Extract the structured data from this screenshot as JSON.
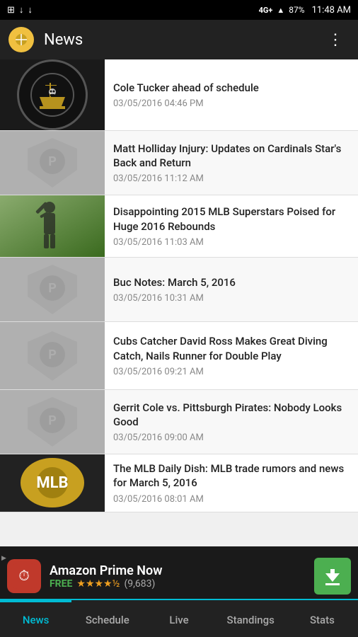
{
  "statusBar": {
    "network": "4G+",
    "signal": "▲",
    "battery": "87%",
    "time": "11:48 AM"
  },
  "topBar": {
    "title": "News",
    "menuIcon": "⋮"
  },
  "newsItems": [
    {
      "id": 1,
      "title": "Cole Tucker ahead of schedule",
      "date": "03/05/2016 04:46 PM",
      "thumbType": "logo"
    },
    {
      "id": 2,
      "title": "Matt Holliday Injury: Updates on Cardinals Star's Back and Return",
      "date": "03/05/2016 11:12 AM",
      "thumbType": "shield"
    },
    {
      "id": 3,
      "title": "Disappointing 2015 MLB Superstars Poised for Huge 2016 Rebounds",
      "date": "03/05/2016 11:03 AM",
      "thumbType": "player"
    },
    {
      "id": 4,
      "title": "Buc Notes: March 5, 2016",
      "date": "03/05/2016 10:31 AM",
      "thumbType": "shield"
    },
    {
      "id": 5,
      "title": "Cubs Catcher David Ross Makes Great Diving Catch, Nails Runner for Double Play",
      "date": "03/05/2016 09:21 AM",
      "thumbType": "shield"
    },
    {
      "id": 6,
      "title": "Gerrit Cole vs. Pittsburgh Pirates: Nobody Looks Good",
      "date": "03/05/2016 09:00 AM",
      "thumbType": "shield"
    },
    {
      "id": 7,
      "title": "The MLB Daily Dish: MLB trade rumors and news for March 5, 2016",
      "date": "03/05/2016 08:01 AM",
      "thumbType": "logo2"
    }
  ],
  "adBanner": {
    "title": "Amazon Prime Now",
    "freeLabel": "FREE",
    "stars": "★★★★½",
    "reviews": "(9,683)",
    "downloadIcon": "↓"
  },
  "bottomNav": {
    "items": [
      {
        "label": "News",
        "active": true
      },
      {
        "label": "Schedule",
        "active": false
      },
      {
        "label": "Live",
        "active": false
      },
      {
        "label": "Standings",
        "active": false
      },
      {
        "label": "Stats",
        "active": false
      }
    ]
  }
}
